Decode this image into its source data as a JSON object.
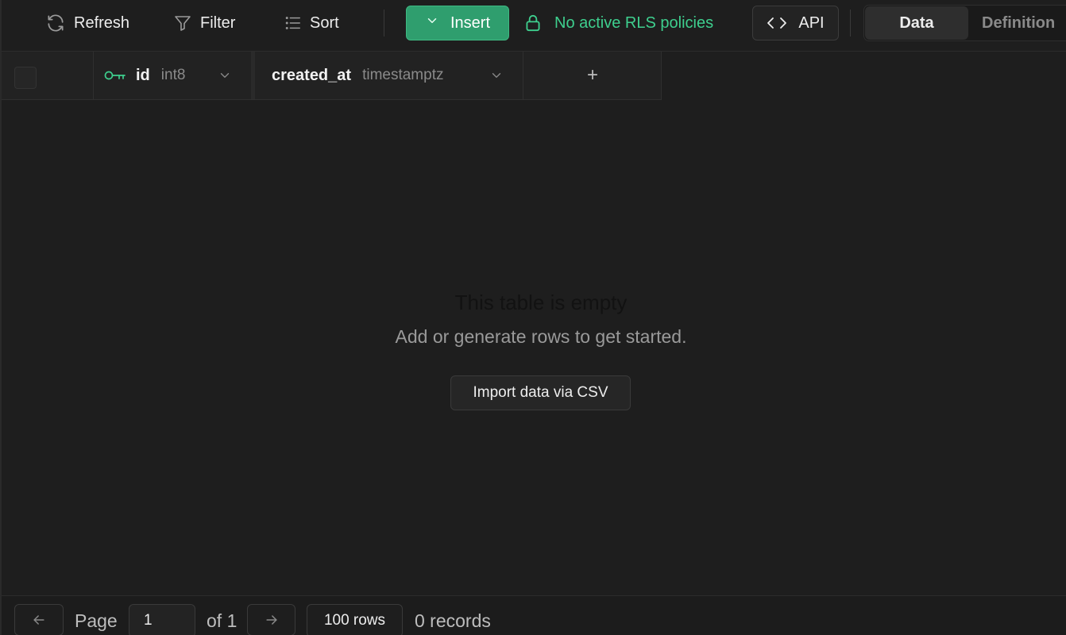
{
  "toolbar": {
    "refresh_label": "Refresh",
    "filter_label": "Filter",
    "sort_label": "Sort",
    "insert_label": "Insert",
    "rls_label": "No active RLS policies",
    "api_label": "API",
    "view_tabs": {
      "data": "Data",
      "definition": "Definition"
    },
    "active_view": "Data"
  },
  "columns": [
    {
      "name": "id",
      "type": "int8",
      "primary_key": true
    },
    {
      "name": "created_at",
      "type": "timestamptz",
      "primary_key": false
    }
  ],
  "add_column_label": "+",
  "empty_state": {
    "title": "This table is empty",
    "subtitle": "Add or generate rows to get started.",
    "import_label": "Import data via CSV"
  },
  "footer": {
    "page_label": "Page",
    "page_value": "1",
    "of_label": "of 1",
    "rows_label": "100 rows",
    "records_label": "0 records"
  },
  "colors": {
    "accent_green": "#3ecf8e",
    "insert_bg": "#2f9e6e",
    "background": "#1e1e1e"
  }
}
